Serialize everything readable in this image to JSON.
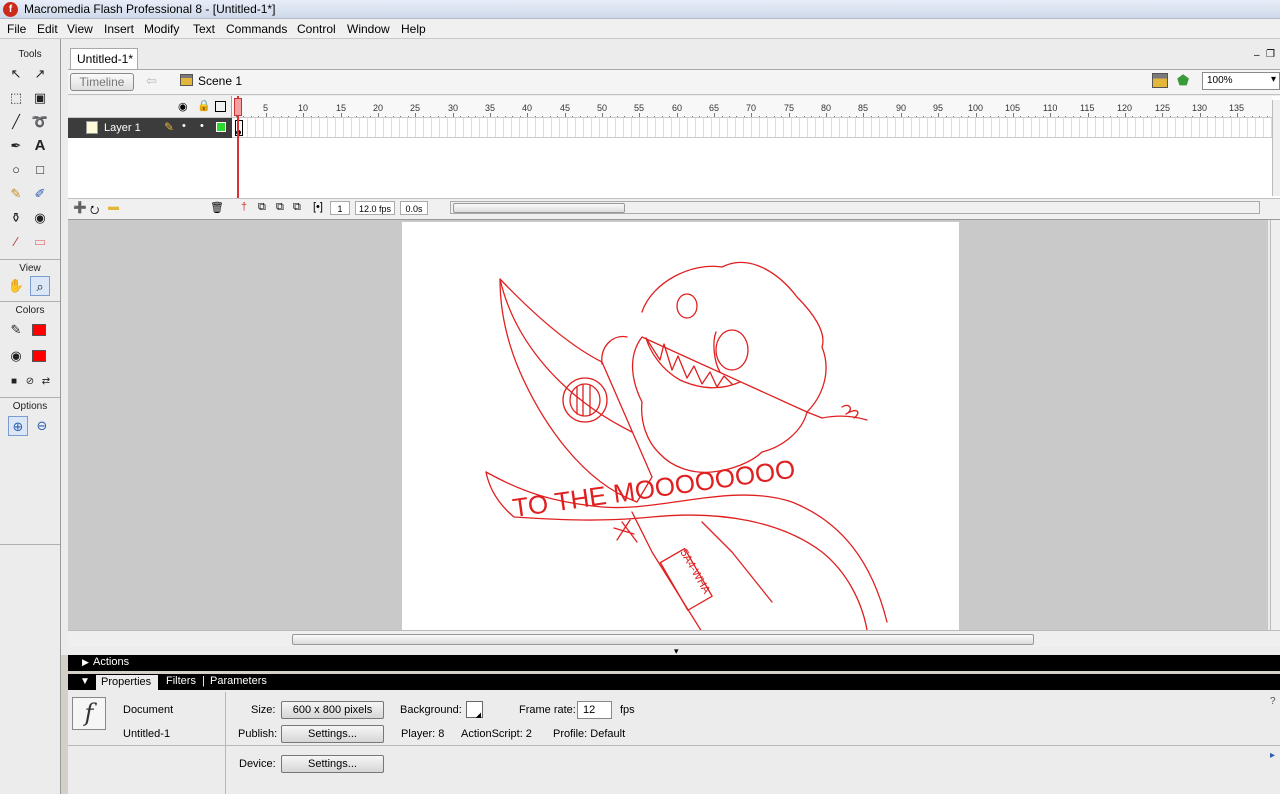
{
  "window": {
    "title": "Macromedia Flash Professional 8 - [Untitled-1*]"
  },
  "menu": [
    "File",
    "Edit",
    "View",
    "Insert",
    "Modify",
    "Text",
    "Commands",
    "Control",
    "Window",
    "Help"
  ],
  "tools": {
    "header": "Tools",
    "view_header": "View",
    "colors_header": "Colors",
    "options_header": "Options",
    "stroke_color": "#ff0000",
    "fill_color": "#ff0000"
  },
  "document": {
    "tab": "Untitled-1*",
    "timeline_button": "Timeline",
    "scene": "Scene 1",
    "zoom": "100%"
  },
  "timeline": {
    "layer_name": "Layer 1",
    "ruler_ticks": [
      "5",
      "10",
      "15",
      "20",
      "25",
      "30",
      "35",
      "40",
      "45",
      "50",
      "55",
      "60",
      "65",
      "70",
      "75",
      "80",
      "85",
      "90",
      "95",
      "100",
      "105",
      "110",
      "115",
      "120",
      "125",
      "130",
      "135"
    ],
    "current_frame": "1",
    "frame_rate": "12.0 fps",
    "elapsed": "0.0s"
  },
  "stage": {
    "banner_text": "TO THE MOOOOOOOO",
    "rocket_text": "5A4-WHA",
    "drawing_color": "#e02020"
  },
  "panels": {
    "actions": "Actions",
    "tabs": [
      "Properties",
      "Filters",
      "Parameters"
    ]
  },
  "properties": {
    "type": "Document",
    "name": "Untitled-1",
    "size_label": "Size:",
    "size_value": "600 x 800 pixels",
    "publish_label": "Publish:",
    "publish_button": "Settings...",
    "device_label": "Device:",
    "device_button": "Settings...",
    "background_label": "Background:",
    "framerate_label": "Frame rate:",
    "framerate_value": "12",
    "fps_unit": "fps",
    "player": "Player: 8",
    "actionscript": "ActionScript:  2",
    "profile": "Profile:  Default"
  }
}
